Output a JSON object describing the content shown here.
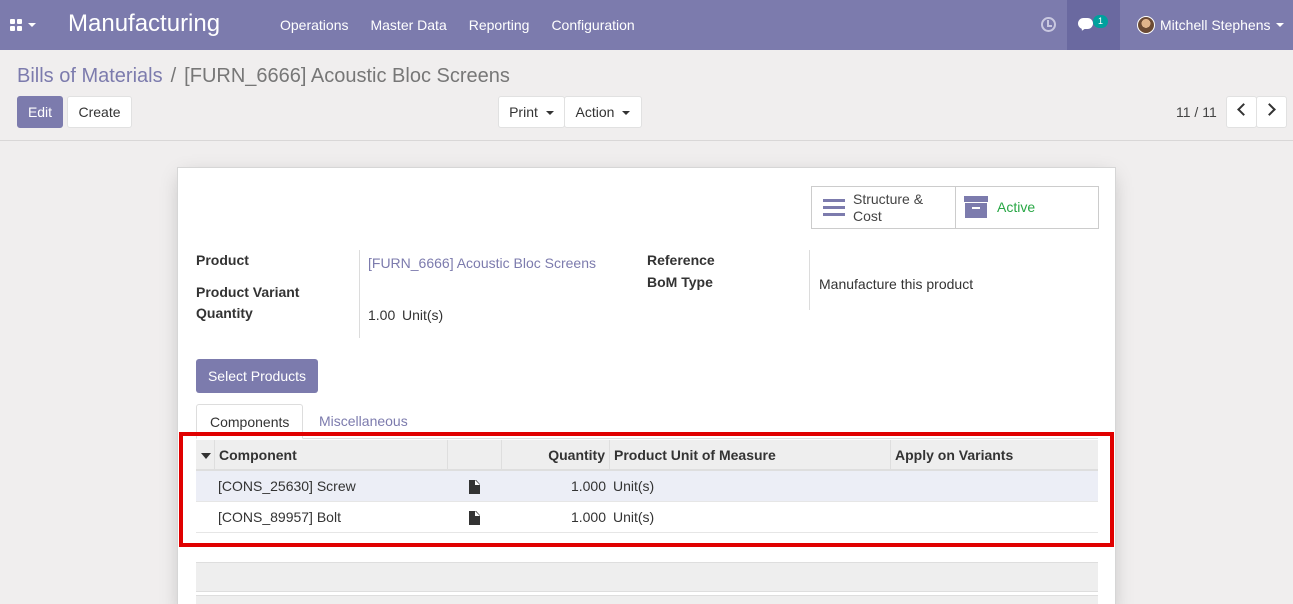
{
  "navbar": {
    "brand": "Manufacturing",
    "menu": [
      "Operations",
      "Master Data",
      "Reporting",
      "Configuration"
    ],
    "chat_count": "1",
    "user_name": "Mitchell Stephens"
  },
  "breadcrumb": {
    "parent": "Bills of Materials",
    "separator": "/",
    "current": "[FURN_6666] Acoustic Bloc Screens"
  },
  "toolbar": {
    "edit_label": "Edit",
    "create_label": "Create",
    "print_label": "Print",
    "action_label": "Action"
  },
  "pager": {
    "value": "11 / 11"
  },
  "smart_buttons": {
    "structure_line1": "Structure &",
    "structure_line2": "Cost",
    "active_label": "Active"
  },
  "form": {
    "product_label": "Product",
    "product_value": "[FURN_6666] Acoustic Bloc Screens",
    "variant_label": "Product Variant",
    "quantity_label": "Quantity",
    "quantity_value": "1.00",
    "quantity_uom": "Unit(s)",
    "reference_label": "Reference",
    "bom_type_label": "BoM Type",
    "bom_type_value": "Manufacture this product"
  },
  "select_products_label": "Select Products",
  "tabs": [
    "Components",
    "Miscellaneous"
  ],
  "components_table": {
    "headers": [
      "Component",
      "",
      "Quantity",
      "Product Unit of Measure",
      "Apply on Variants"
    ],
    "rows": [
      {
        "component": "[CONS_25630] Screw",
        "quantity": "1.000",
        "uom": "Unit(s)",
        "variants": ""
      },
      {
        "component": "[CONS_89957] Bolt",
        "quantity": "1.000",
        "uom": "Unit(s)",
        "variants": ""
      }
    ]
  },
  "colors": {
    "brand": "#7c7bad",
    "active_green": "#28a745",
    "highlight_red": "#e00000"
  }
}
